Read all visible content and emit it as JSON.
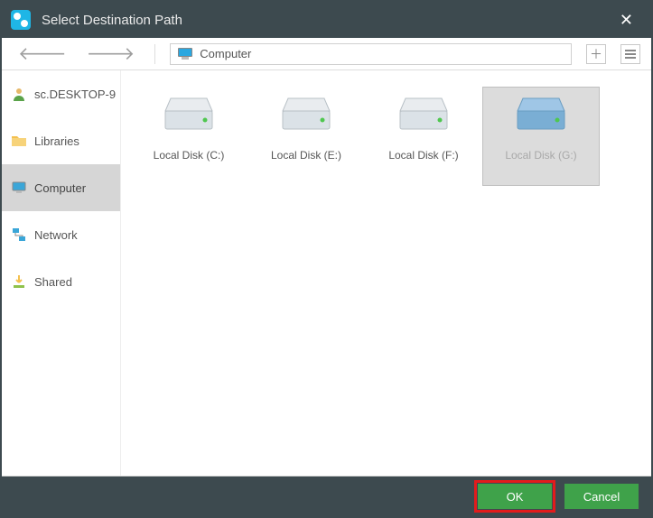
{
  "title": "Select Destination Path",
  "path": {
    "label": "Computer"
  },
  "sidebar": {
    "items": [
      {
        "label": "sc.DESKTOP-9",
        "icon": "user-icon"
      },
      {
        "label": "Libraries",
        "icon": "folder-icon"
      },
      {
        "label": "Computer",
        "icon": "monitor-icon",
        "selected": true
      },
      {
        "label": "Network",
        "icon": "network-icon"
      },
      {
        "label": "Shared",
        "icon": "download-icon"
      }
    ]
  },
  "disks": [
    {
      "label": "Local Disk (C:)",
      "selected": false
    },
    {
      "label": "Local Disk (E:)",
      "selected": false
    },
    {
      "label": "Local Disk (F:)",
      "selected": false
    },
    {
      "label": "Local Disk (G:)",
      "selected": true
    }
  ],
  "buttons": {
    "ok": "OK",
    "cancel": "Cancel"
  }
}
